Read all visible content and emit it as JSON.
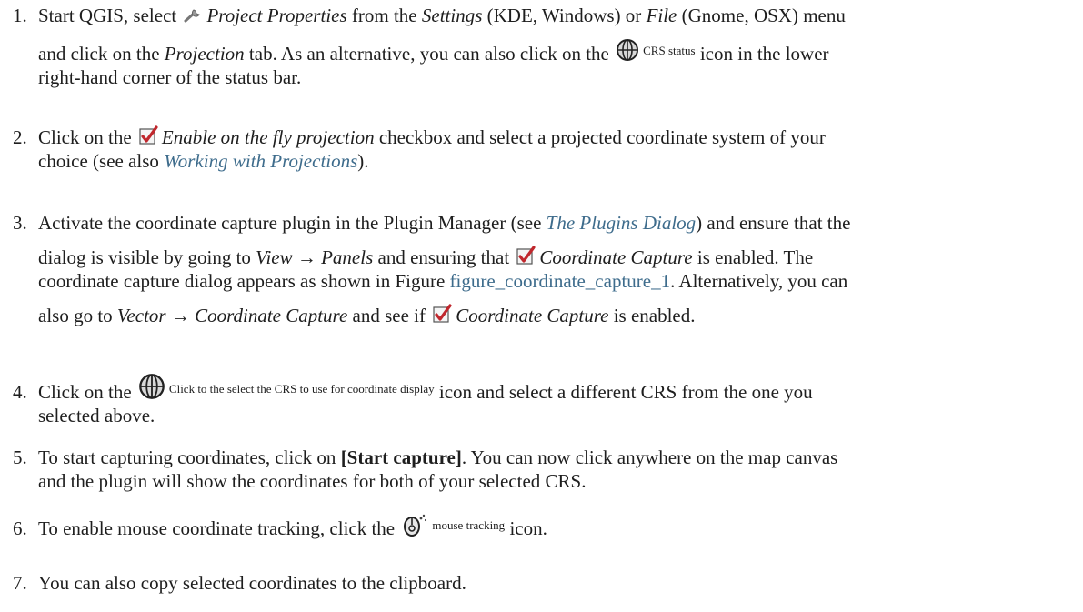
{
  "steps": [
    {
      "number": "1.",
      "lines": [
        {
          "t1": "Start QGIS, select",
          "i1": "Project Properties",
          "t2": "from the",
          "i2": "Settings",
          "t3": "(KDE, Windows) or",
          "i3": "File",
          "t4": "(Gnome, OSX) menu"
        },
        {
          "t1": "and click on the",
          "i1": "Projection",
          "t2": "tab. As an alternative, you can also click on the",
          "icon_label": "CRS status",
          "t3": "icon in the lower"
        },
        {
          "t1": "right-hand corner of the status bar."
        }
      ]
    },
    {
      "number": "2.",
      "lines": [
        {
          "t1": "Click on the",
          "i1": "Enable on the fly projection",
          "t2": "checkbox and select a projected coordinate system of your"
        },
        {
          "t1": "choice (see also",
          "link": "Working with Projections",
          "t2": ")."
        }
      ]
    },
    {
      "number": "3.",
      "lines": [
        {
          "t1": "Activate the coordinate capture plugin in the Plugin Manager (see",
          "link": "The Plugins Dialog",
          "t2": ") and ensure that the"
        },
        {
          "t1": "dialog is visible by going to",
          "i1": "View",
          "arrow": "→",
          "i2": "Panels",
          "t2": "and ensuring that",
          "i3": "Coordinate Capture",
          "t3": "is enabled.  The"
        },
        {
          "t1": "coordinate capture dialog appears as shown in Figure",
          "link": "figure_coordinate_capture_1",
          "t2": ". Alternatively, you can"
        },
        {
          "t1": "also go to",
          "i1": "Vector",
          "arrow": "→",
          "i2": "Coordinate Capture",
          "t2": "and see if",
          "i3": "Coordinate Capture",
          "t3": "is enabled."
        }
      ]
    },
    {
      "number": "4.",
      "lines": [
        {
          "t1": "Click on the",
          "icon_label": "Click to the select the CRS to use for coordinate display",
          "t2": "icon and select a different CRS from the one you"
        },
        {
          "t1": "selected above."
        }
      ]
    },
    {
      "number": "5.",
      "lines": [
        {
          "t1": "To start capturing coordinates, click on",
          "b1": "[Start capture]",
          "t2": ". You can now click anywhere on the map canvas"
        },
        {
          "t1": "and the plugin will show the coordinates for both of your selected CRS."
        }
      ]
    },
    {
      "number": "6.",
      "lines": [
        {
          "t1": "To enable mouse coordinate tracking, click the",
          "icon_label": "mouse tracking",
          "t2": "icon."
        }
      ]
    },
    {
      "number": "7.",
      "lines": [
        {
          "t1": "You can also copy selected coordinates to the clipboard."
        }
      ]
    }
  ],
  "icons": {
    "wrench": "wrench-icon",
    "crs": "crs-globe-icon",
    "checkbox": "checked-checkbox-icon",
    "mouse": "mouse-tracking-icon"
  },
  "colors": {
    "text": "#1e1e1e",
    "link": "#3e6c8c",
    "check": "#c0272d"
  }
}
